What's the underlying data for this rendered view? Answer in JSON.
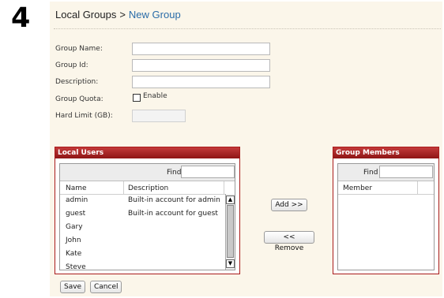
{
  "step_number": "4",
  "breadcrumb": {
    "parent": "Local Groups",
    "separator": ">",
    "current": "New Group"
  },
  "form": {
    "group_name_label": "Group Name:",
    "group_id_label": "Group Id:",
    "description_label": "Description:",
    "group_quota_label": "Group Quota:",
    "enable_label": "Enable",
    "hard_limit_label": "Hard Limit (GB):"
  },
  "local_users": {
    "title": "Local Users",
    "find_label": "Find",
    "columns": [
      "Name",
      "Description"
    ],
    "rows": [
      {
        "name": "admin",
        "description": "Built-in account for admini"
      },
      {
        "name": "guest",
        "description": "Built-in account for guest"
      },
      {
        "name": "Gary",
        "description": ""
      },
      {
        "name": "John",
        "description": ""
      },
      {
        "name": "Kate",
        "description": ""
      },
      {
        "name": "Steve",
        "description": ""
      }
    ]
  },
  "group_members": {
    "title": "Group Members",
    "find_label": "Find",
    "columns": [
      "Member"
    ]
  },
  "buttons": {
    "add": "Add >>",
    "remove": "<< Remove",
    "save": "Save",
    "cancel": "Cancel"
  },
  "colors": {
    "accent": "#a91b1b",
    "panel_bg": "#fbf6ea",
    "link": "#2a6ca8"
  }
}
